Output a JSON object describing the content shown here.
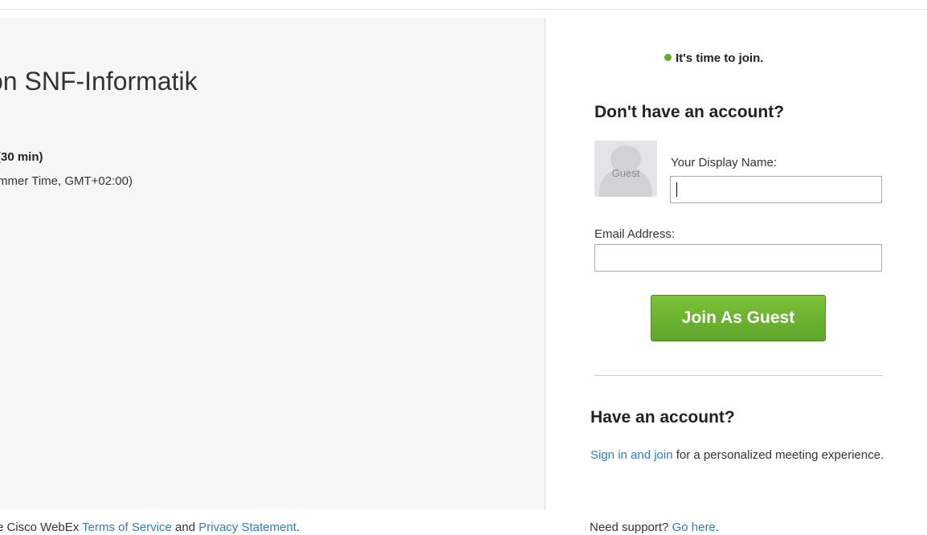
{
  "meeting": {
    "title": "on SNF-Informatik",
    "duration": "(30 min)",
    "time": "mmer Time, GMT+02:00)"
  },
  "status": {
    "text": "It's time to join.",
    "dot_color": "#6aaa2b"
  },
  "guest_section": {
    "heading": "Don't have an account?",
    "avatar_label": "Guest",
    "display_name_label": "Your Display Name:",
    "display_name_value": "",
    "email_label": "Email Address:",
    "email_value": "",
    "join_button_label": "Join As Guest",
    "button_color": "#6ab033"
  },
  "account_section": {
    "heading": "Have an account?",
    "signin_link": "Sign in and join",
    "signin_rest": " for a personalized meeting experience."
  },
  "footer": {
    "left_prefix": "e Cisco WebEx ",
    "terms_link": "Terms of Service",
    "and_text": " and ",
    "privacy_link": "Privacy Statement",
    "left_suffix": ".",
    "support_text": "Need support? ",
    "support_link": "Go here",
    "support_suffix": "."
  },
  "colors": {
    "link": "#2e7db8",
    "left_panel_bg": "#f6f6f6"
  }
}
